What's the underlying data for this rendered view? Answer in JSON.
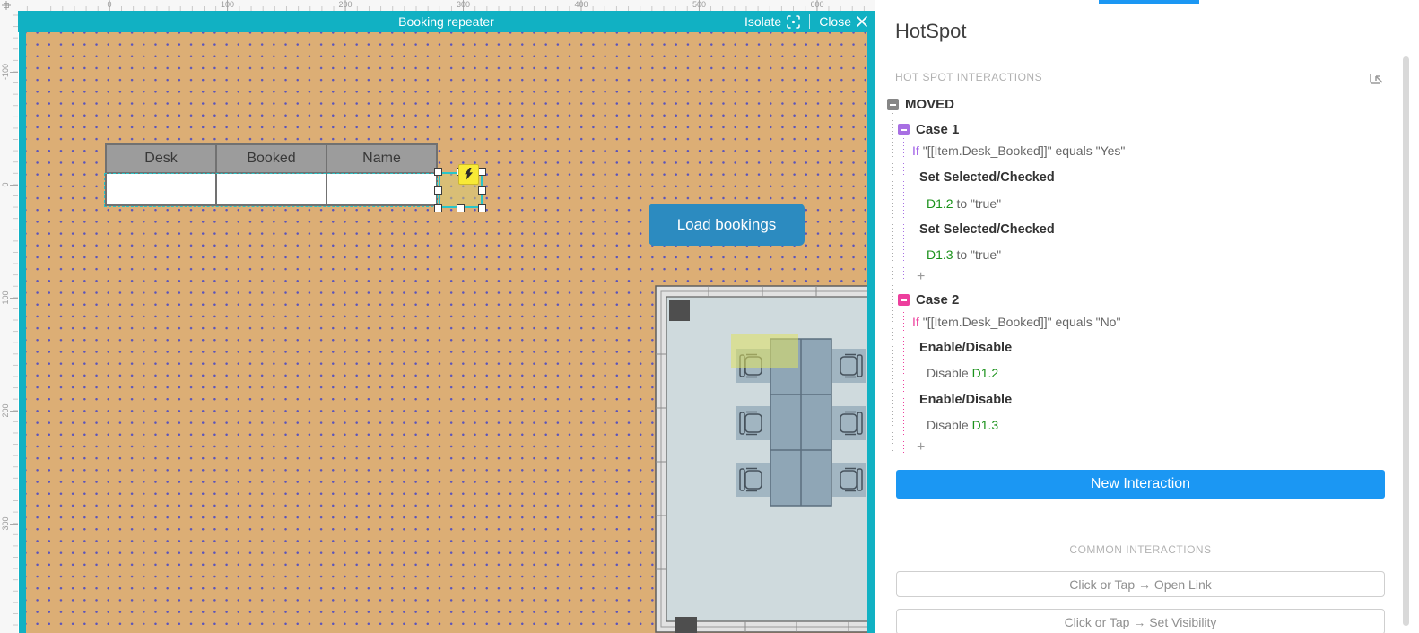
{
  "colors": {
    "accent_teal": "#11b1c3",
    "canvas_tan": "#dcae75",
    "canvas_dot": "#5b54bb",
    "widget_blue": "#2c8bc0",
    "panel_blue": "#1b97f3",
    "case1_purple": "#a86fe3",
    "case2_pink": "#ed3f9d",
    "target_green": "#1a911a",
    "selection_teal": "#28c5c9"
  },
  "icons": {
    "isolate": "frame-focus-icon",
    "close": "x-icon",
    "corner": "ruler-origin-icon",
    "select_mode": "box-arrow-select-icon",
    "collapse": "minus-box-icon",
    "interaction_badge": "lightning-bolt-icon"
  },
  "rulers": {
    "horizontal": [
      "0",
      "100",
      "200",
      "300",
      "400",
      "500",
      "600"
    ],
    "vertical": [
      "-100",
      "0",
      "100",
      "200",
      "300"
    ]
  },
  "isolation_header": {
    "title": "Booking repeater",
    "isolate_label": "Isolate",
    "close_label": "Close"
  },
  "canvas": {
    "table": {
      "headers": [
        "Desk",
        "Booked",
        "Name"
      ]
    },
    "load_button": {
      "label": "Load bookings"
    }
  },
  "panel": {
    "title": "HotSpot",
    "section_header": "HOT SPOT INTERACTIONS",
    "event": {
      "name": "MOVED"
    },
    "cases": [
      {
        "name": "Case 1",
        "if_keyword": "If",
        "condition": "\"[[Item.Desk_Booked]]\" equals \"Yes\"",
        "actions": [
          {
            "title": "Set Selected/Checked",
            "prefix": "",
            "target": "D1.2",
            "suffix": " to \"true\""
          },
          {
            "title": "Set Selected/Checked",
            "prefix": "",
            "target": "D1.3",
            "suffix": " to \"true\""
          }
        ],
        "add_label": "+"
      },
      {
        "name": "Case 2",
        "if_keyword": "If",
        "condition": "\"[[Item.Desk_Booked]]\" equals \"No\"",
        "actions": [
          {
            "title": "Enable/Disable",
            "prefix": "Disable ",
            "target": "D1.2",
            "suffix": ""
          },
          {
            "title": "Enable/Disable",
            "prefix": "Disable ",
            "target": "D1.3",
            "suffix": ""
          }
        ],
        "add_label": "+"
      }
    ],
    "new_interaction_label": "New Interaction",
    "common_header": "COMMON INTERACTIONS",
    "common_buttons": [
      "Click or Tap → Open Link",
      "Click or Tap → Set Visibility"
    ]
  }
}
